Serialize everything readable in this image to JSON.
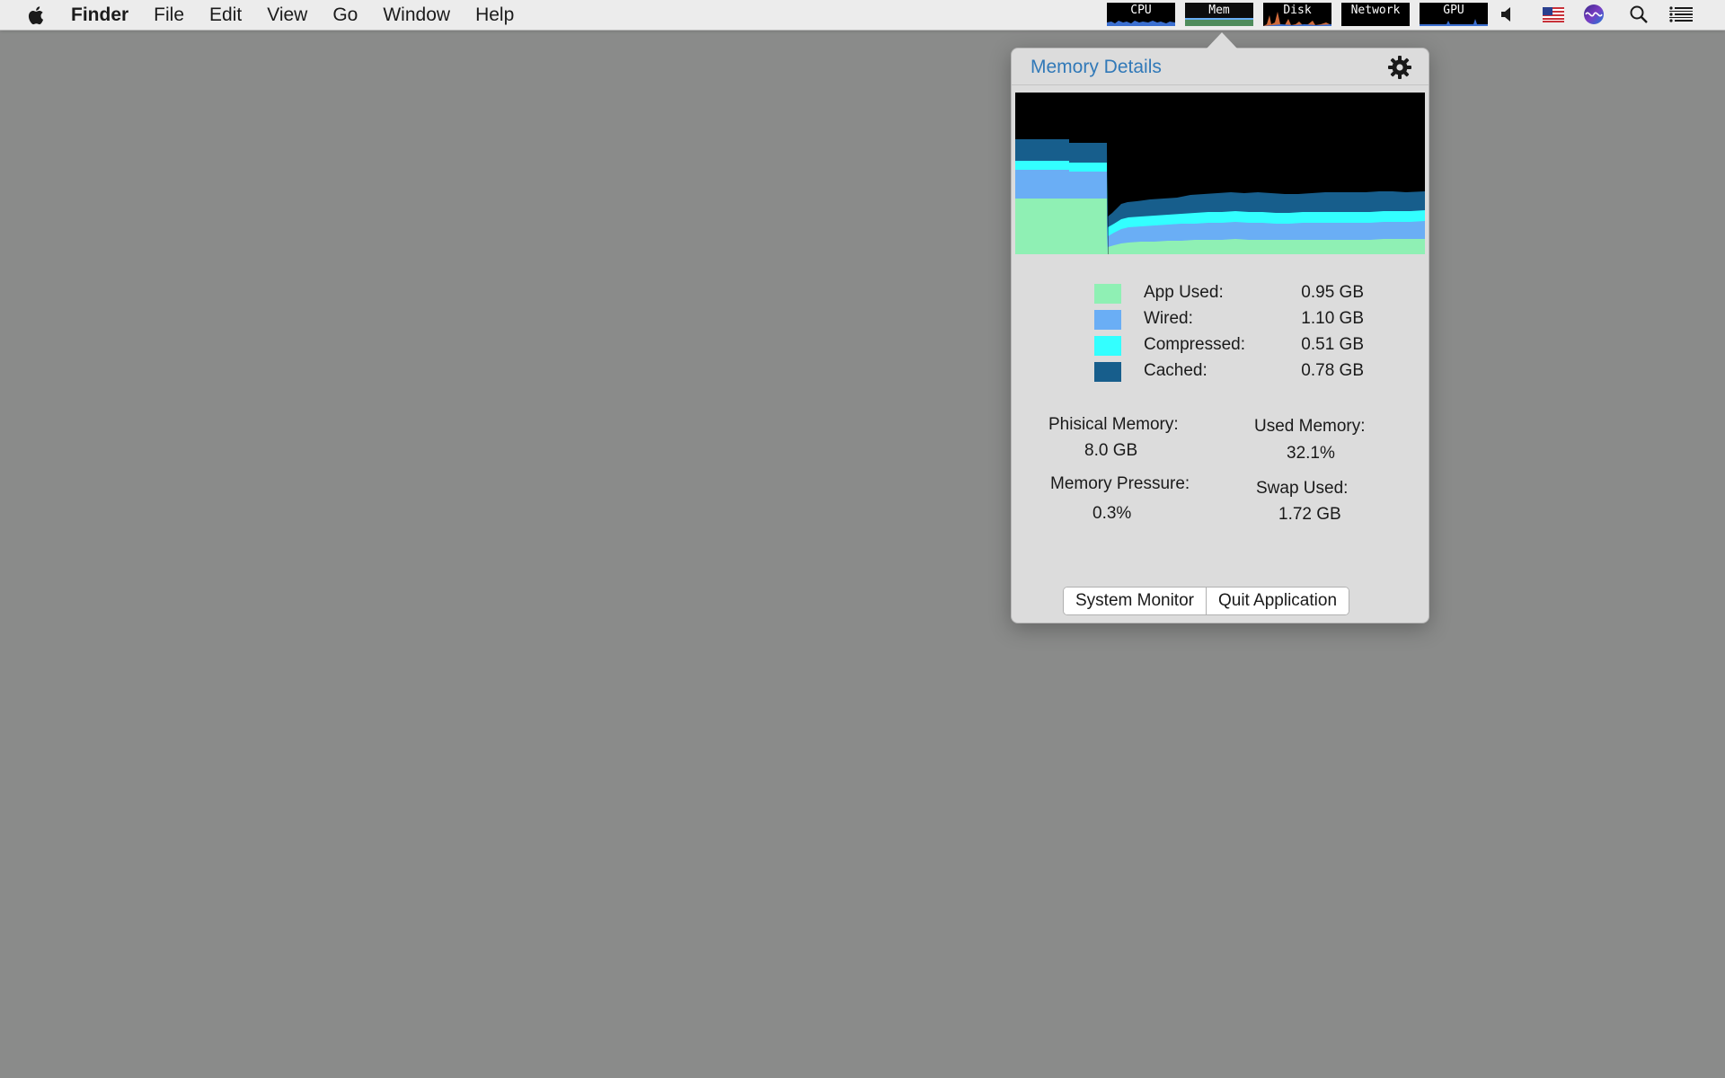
{
  "menubar": {
    "app_name": "Finder",
    "items": [
      "File",
      "Edit",
      "View",
      "Go",
      "Window",
      "Help"
    ],
    "meters": [
      {
        "label": "CPU",
        "icon": "cpu-meter"
      },
      {
        "label": "Mem",
        "icon": "memory-meter"
      },
      {
        "label": "Disk",
        "icon": "disk-meter"
      },
      {
        "label": "Network",
        "icon": "network-meter"
      },
      {
        "label": "GPU",
        "icon": "gpu-meter"
      }
    ],
    "status_icons": [
      "volume-icon",
      "us-flag-icon",
      "siri-icon",
      "search-icon",
      "list-icon"
    ]
  },
  "popover": {
    "title": "Memory Details",
    "legend": [
      {
        "label": "App Used:",
        "value": "0.95 GB",
        "color": "#8ff0b4"
      },
      {
        "label": "Wired:",
        "value": "1.10 GB",
        "color": "#6aaef5"
      },
      {
        "label": "Compressed:",
        "value": "0.51 GB",
        "color": "#33ffff"
      },
      {
        "label": "Cached:",
        "value": "0.78 GB",
        "color": "#175e8c"
      }
    ],
    "stats": {
      "physical_label": "Phisical Memory:",
      "physical_value": "8.0 GB",
      "used_label": "Used Memory:",
      "used_value": "32.1%",
      "pressure_label": "Memory Pressure:",
      "pressure_value": "0.3%",
      "swap_label": "Swap Used:",
      "swap_value": "1.72 GB"
    },
    "buttons": {
      "system_monitor": "System Monitor",
      "quit": "Quit Application"
    }
  },
  "colors": {
    "title_blue": "#3179b8",
    "app_used": "#8ff0b4",
    "wired": "#6aaef5",
    "compressed": "#33ffff",
    "cached": "#175e8c",
    "desktop": "#8a8b8a"
  }
}
